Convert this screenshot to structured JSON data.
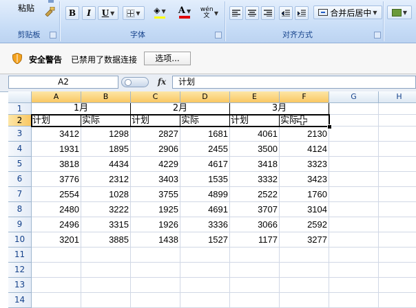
{
  "ribbon": {
    "clipboard": {
      "paste_label": "粘贴",
      "group_label": "剪贴板"
    },
    "font": {
      "group_label": "字体",
      "bold": "B",
      "italic": "I",
      "underline": "U",
      "font_color_letter": "A",
      "phonetic_label": "wén 文"
    },
    "alignment": {
      "group_label": "对齐方式",
      "merge_label": "合并后居中"
    }
  },
  "security": {
    "title": "安全警告",
    "message": "已禁用了数据连接",
    "options_button": "选项..."
  },
  "formula_bar": {
    "name_box": "A2",
    "fx_label": "fx",
    "content": "计划"
  },
  "columns": [
    "A",
    "B",
    "C",
    "D",
    "E",
    "F",
    "G",
    "H"
  ],
  "rows": [
    "1",
    "2",
    "3",
    "4",
    "5",
    "6",
    "7",
    "8",
    "9",
    "10",
    "11",
    "12",
    "13",
    "14"
  ],
  "sheet": {
    "months": [
      "1月",
      "2月",
      "3月"
    ],
    "subheaders": [
      "计划",
      "实际",
      "计划",
      "实际",
      "计划",
      "实际"
    ],
    "data": [
      [
        3412,
        1298,
        2827,
        1681,
        4061,
        2130
      ],
      [
        1931,
        1895,
        2906,
        2455,
        3500,
        4124
      ],
      [
        3818,
        4434,
        4229,
        4617,
        3418,
        3323
      ],
      [
        3776,
        2312,
        3403,
        1535,
        3332,
        3423
      ],
      [
        2554,
        1028,
        3755,
        4899,
        2522,
        1760
      ],
      [
        2480,
        3222,
        1925,
        4691,
        3707,
        3104
      ],
      [
        2496,
        3315,
        1926,
        3336,
        3066,
        2592
      ],
      [
        3201,
        3885,
        1438,
        1527,
        1177,
        3277
      ]
    ]
  },
  "colors": {
    "accent": "#15428b",
    "selected_header": "#f9c763",
    "ribbon": "#c5dbf6"
  }
}
